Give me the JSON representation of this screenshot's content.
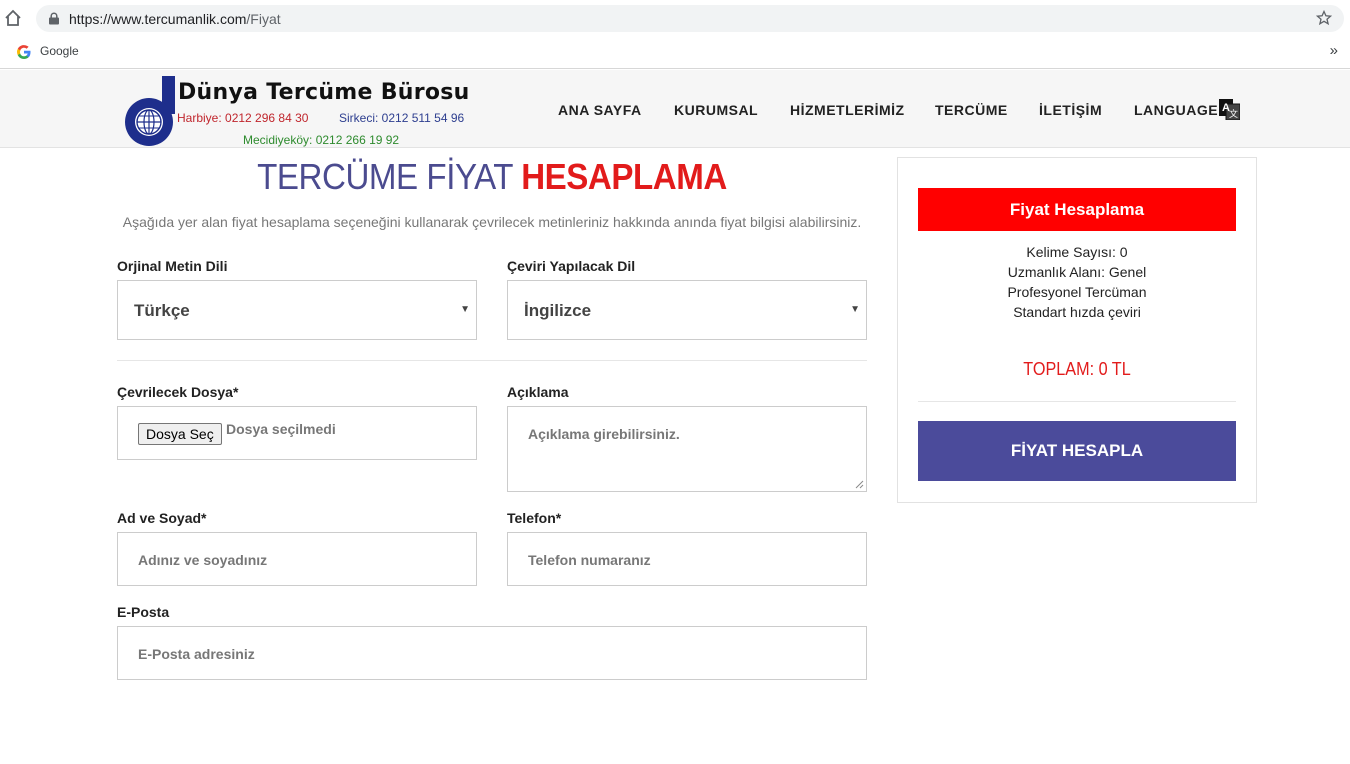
{
  "browser": {
    "url_host": "https://www.tercumanlik.com",
    "url_path": "/Fiyat",
    "bookmark_label": "Google",
    "bookmarks_more": "»"
  },
  "logo": {
    "title": "Dünya Tercüme Bürosu",
    "line1_a": "Harbiye: 0212 296 84 30",
    "line1_b": "Sirkeci: 0212 511 54 96",
    "line2": "Mecidiyeköy: 0212 266 19 92"
  },
  "nav": {
    "items": [
      "ANA SAYFA",
      "KURUMSAL",
      "HİZMETLERİMİZ",
      "TERCÜME",
      "İLETİŞİM",
      "LANGUAGE"
    ]
  },
  "page": {
    "title_part1": "TERCÜME FİYAT ",
    "title_part2": "HESAPLAMA",
    "intro": "Aşağıda yer alan fiyat hesaplama seçeneğini kullanarak çevrilecek metinleriniz hakkında anında fiyat bilgisi alabilirsiniz."
  },
  "form": {
    "source_lang_label": "Orjinal Metin Dili",
    "source_lang_value": "Türkçe",
    "target_lang_label": "Çeviri Yapılacak Dil",
    "target_lang_value": "İngilizce",
    "file_label": "Çevrilecek Dosya*",
    "file_button": "Dosya Seç",
    "file_status": "Dosya seçilmedi",
    "desc_label": "Açıklama",
    "desc_placeholder": "Açıklama girebilirsiniz.",
    "name_label": "Ad ve Soyad*",
    "name_placeholder": "Adınız ve soyadınız",
    "phone_label": "Telefon*",
    "phone_placeholder": "Telefon numaranız",
    "email_label": "E-Posta",
    "email_placeholder": "E-Posta adresiniz"
  },
  "sidebar": {
    "header": "Fiyat Hesaplama",
    "word_count": "Kelime Sayısı: 0",
    "field": "Uzmanlık Alanı: Genel",
    "translator": "Profesyonel Tercüman",
    "speed": "Standart hızda çeviri",
    "total": "TOPLAM: 0 TL",
    "button": "FİYAT HESAPLA"
  },
  "colors": {
    "brand_blue": "#4b4b9b",
    "accent_red": "#ff0000",
    "title_blue": "#4b4b8f"
  }
}
